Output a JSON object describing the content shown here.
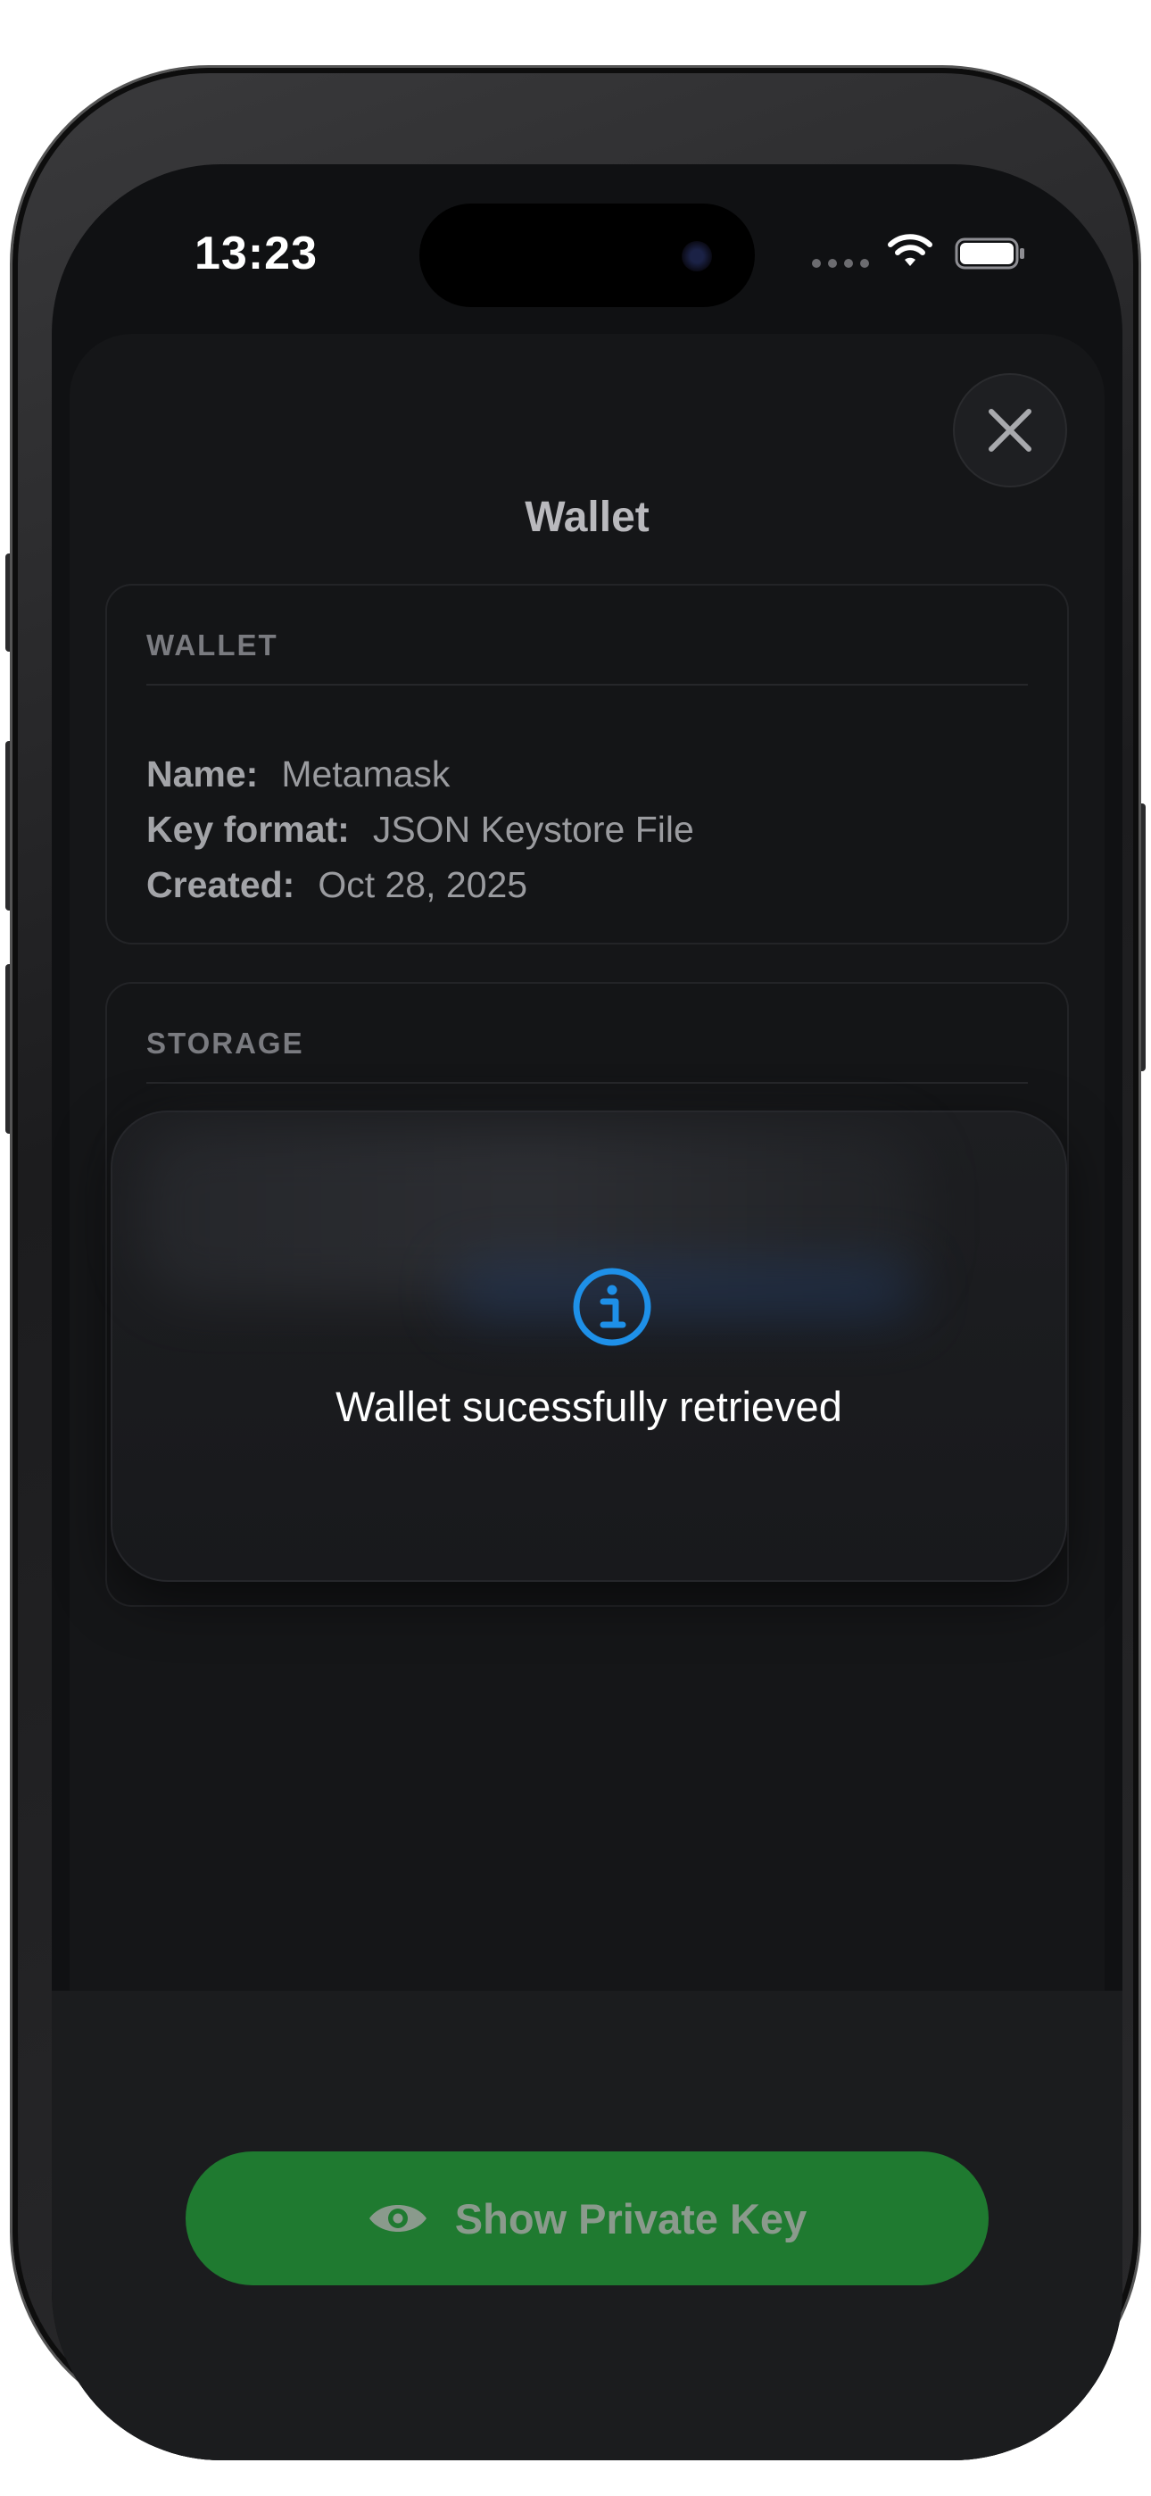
{
  "status_bar": {
    "time": "13:23",
    "icons": [
      "signal-dots-icon",
      "wifi-icon",
      "battery-icon"
    ]
  },
  "sheet": {
    "title": "Wallet",
    "close_icon": "close-icon"
  },
  "wallet_card": {
    "header": "WALLET",
    "name_label": "Name:",
    "name_value": "Metamask",
    "format_label": "Key format:",
    "format_value": "JSON Keystore File",
    "created_label": "Created:",
    "created_value": "Oct 28, 2025"
  },
  "storage_card": {
    "header": "STORAGE"
  },
  "toast": {
    "icon": "info-circle-icon",
    "message": "Wallet sucessfully retrieved",
    "accent": "#1e90e8"
  },
  "action": {
    "label": "Show Private Key",
    "icon": "eye-icon",
    "color": "#1f7a30"
  }
}
